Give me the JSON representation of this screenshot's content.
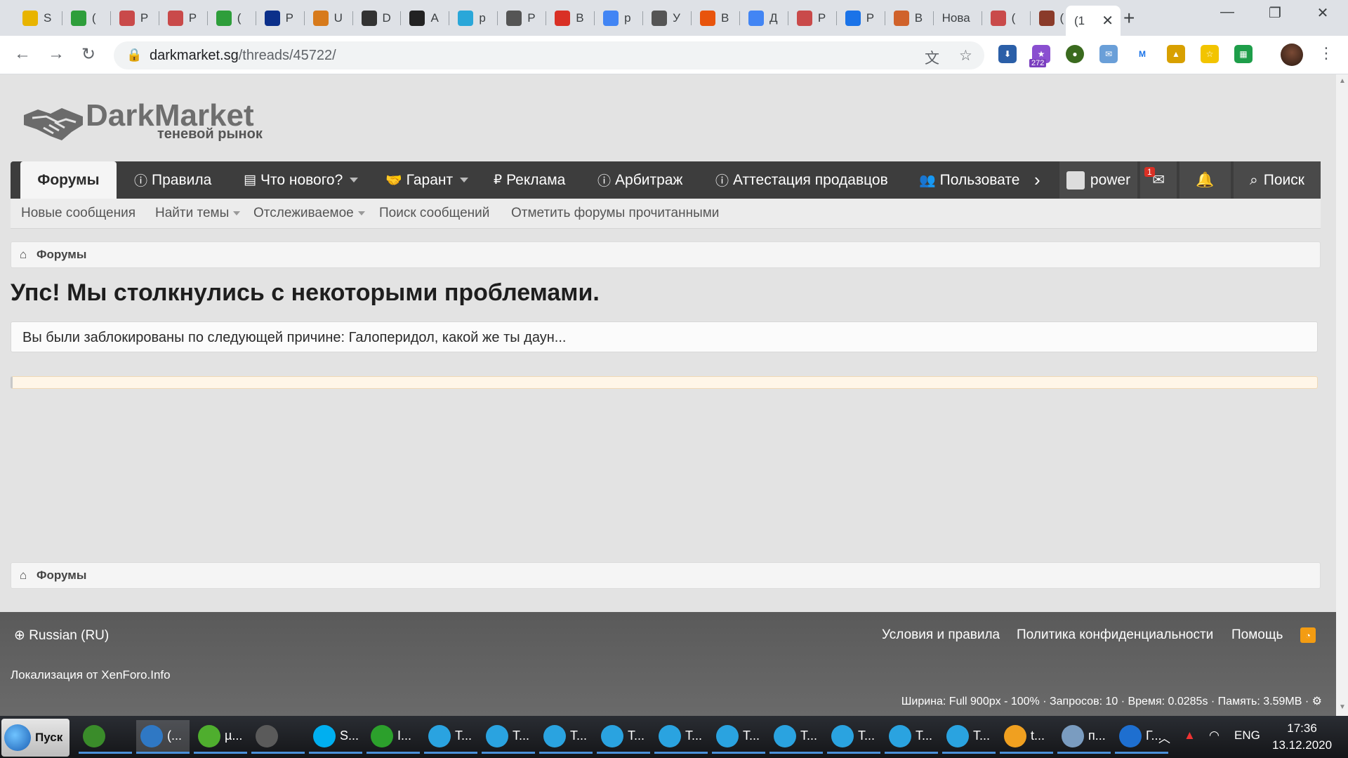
{
  "browser": {
    "tabs": [
      {
        "label": "S",
        "color": "#e8b400"
      },
      {
        "label": "(",
        "color": "#2e9e3b"
      },
      {
        "label": "P",
        "color": "#c94a4a"
      },
      {
        "label": "P",
        "color": "#c94a4a"
      },
      {
        "label": "(",
        "color": "#2e9e3b"
      },
      {
        "label": "P",
        "color": "#0b2f8a"
      },
      {
        "label": "U",
        "color": "#d77a1b"
      },
      {
        "label": "D",
        "color": "#333333"
      },
      {
        "label": "A",
        "color": "#222222"
      },
      {
        "label": "p",
        "color": "#2aa7d9"
      },
      {
        "label": "P",
        "color": "#555555"
      },
      {
        "label": "B",
        "color": "#d93025"
      },
      {
        "label": "p",
        "color": "#4285f4"
      },
      {
        "label": "У",
        "color": "#555555"
      },
      {
        "label": "B",
        "color": "#e8540c"
      },
      {
        "label": "Д",
        "color": "#4285f4"
      },
      {
        "label": "P",
        "color": "#c94a4a"
      },
      {
        "label": "P",
        "color": "#1a73e8"
      },
      {
        "label": "B",
        "color": "#d0622b"
      },
      {
        "label": "Нова",
        "color": ""
      },
      {
        "label": "(",
        "color": "#c94a4a"
      },
      {
        "label": "(",
        "color": "#8a3b2a"
      }
    ],
    "active_tab": "(1",
    "url_host": "darkmarket.sg",
    "url_path": "/threads/45722/",
    "ext_badge": "272"
  },
  "site": {
    "logo_name": "DarkMarket",
    "logo_sub": "теневой рынок",
    "nav": [
      {
        "label": "Форумы"
      },
      {
        "label": "Правила",
        "icon": "ⓘ"
      },
      {
        "label": "Что нового?",
        "icon": "▤"
      },
      {
        "label": "Гарант",
        "icon": "🤝"
      },
      {
        "label": "Реклама",
        "icon": "₽"
      },
      {
        "label": "Арбитраж",
        "icon": "ⓘ"
      },
      {
        "label": "Аттестация продавцов",
        "icon": "ⓘ"
      },
      {
        "label": "Пользовате",
        "icon": "👥"
      }
    ],
    "user": "power",
    "inbox_count": "1",
    "search_label": "Поиск",
    "subnav": [
      "Новые сообщения",
      "Найти темы",
      "Отслеживаемое",
      "Поиск сообщений",
      "Отметить форумы прочитанными"
    ],
    "breadcrumb": "Форумы",
    "error_title": "Упс! Мы столкнулись с некоторыми проблемами.",
    "error_message": "Вы были заблокированы по следующей причине: Галоперидол, какой же ты даун...",
    "footer": {
      "language": "Russian (RU)",
      "links": [
        "Условия и правила",
        "Политика конфиденциальности",
        "Помощь"
      ],
      "localization": "Локализация от XenForo.Info",
      "stats": "Ширина: Full 900px - 100% · Запросов: 10 · Время: 0.0285s · Память: 3.59MB ·"
    }
  },
  "taskbar": {
    "start_label": "Пуск",
    "tasks": [
      {
        "label": "",
        "color": "#3a8c2a"
      },
      {
        "label": "(...",
        "color": "#2f78c4"
      },
      {
        "label": "µ...",
        "color": "#4fae2e"
      },
      {
        "label": "",
        "color": "#5a5a5a"
      },
      {
        "label": "S...",
        "color": "#00aff0"
      },
      {
        "label": "I...",
        "color": "#2ca02c"
      },
      {
        "label": "T...",
        "color": "#2aa3e0"
      },
      {
        "label": "T...",
        "color": "#2aa3e0"
      },
      {
        "label": "T...",
        "color": "#2aa3e0"
      },
      {
        "label": "T...",
        "color": "#2aa3e0"
      },
      {
        "label": "T...",
        "color": "#2aa3e0"
      },
      {
        "label": "T...",
        "color": "#2aa3e0"
      },
      {
        "label": "T...",
        "color": "#2aa3e0"
      },
      {
        "label": "T...",
        "color": "#2aa3e0"
      },
      {
        "label": "T...",
        "color": "#2aa3e0"
      },
      {
        "label": "T...",
        "color": "#2aa3e0"
      },
      {
        "label": "t...",
        "color": "#f0a020"
      },
      {
        "label": "п...",
        "color": "#7a9cc0"
      },
      {
        "label": "Г...",
        "color": "#1e6fd0"
      }
    ],
    "lang": "ENG",
    "time": "17:36",
    "date": "13.12.2020"
  }
}
